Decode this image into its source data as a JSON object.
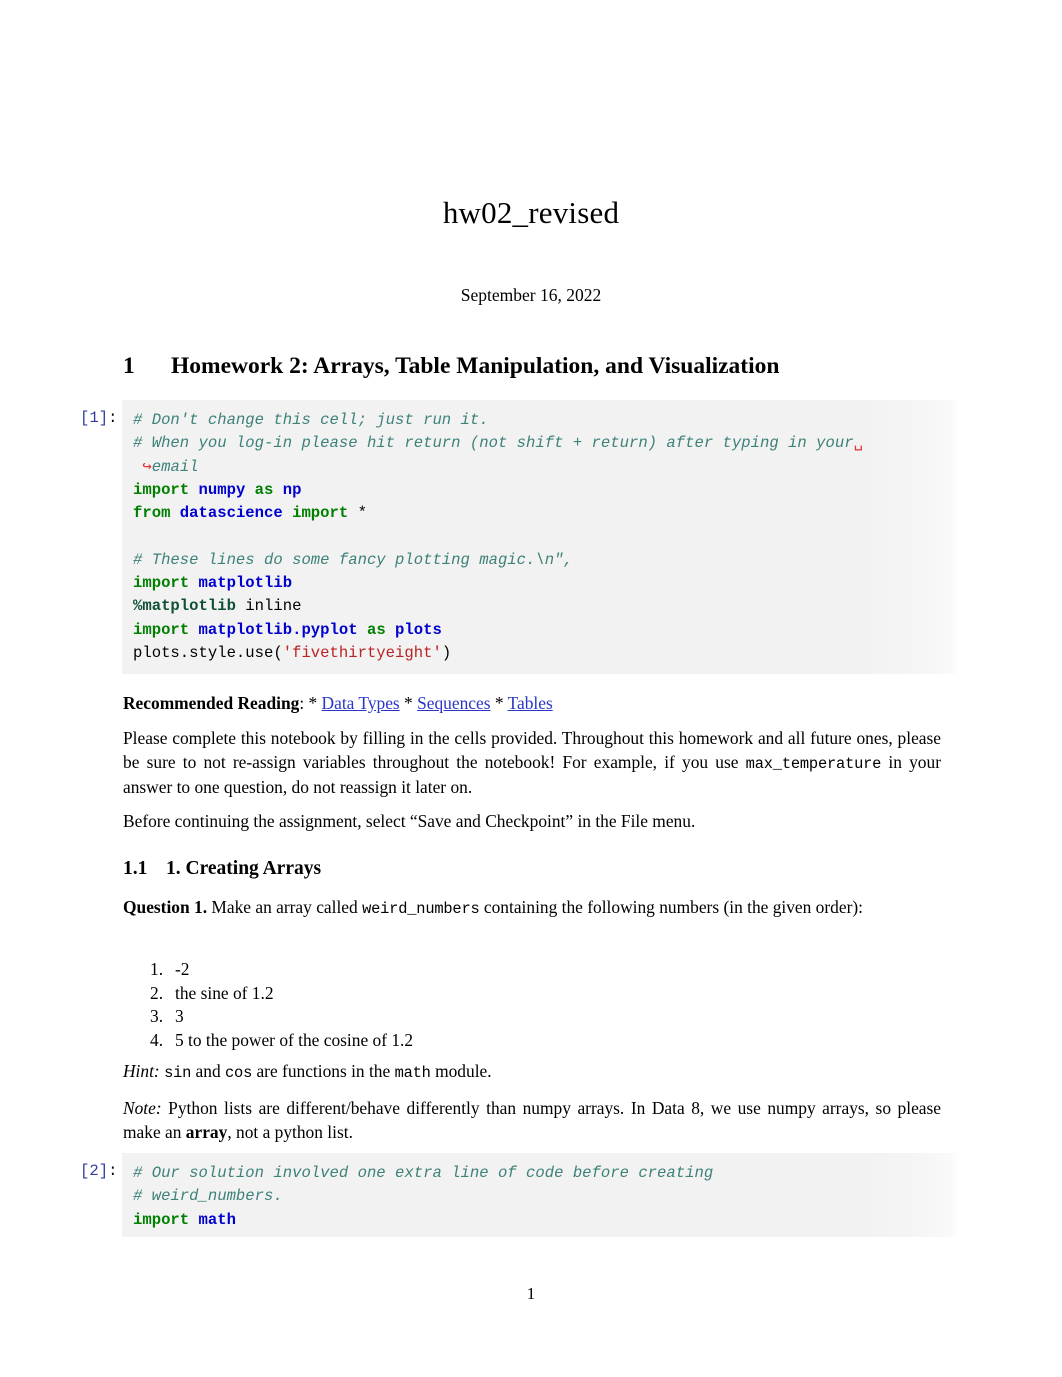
{
  "document": {
    "title": "hw02_revised",
    "date": "September 16, 2022",
    "page_number": "1"
  },
  "sections": {
    "h1": {
      "number": "1",
      "text": "Homework 2: Arrays, Table Manipulation, and Visualization"
    },
    "h2": {
      "number": "1.1",
      "text": "1. Creating Arrays"
    }
  },
  "cells": [
    {
      "label": "[1]",
      "lines": [
        "# Don't change this cell; just run it.",
        "# When you log-in please hit return (not shift + return) after typing in your",
        "email",
        "import numpy as np",
        "from datascience import *",
        "",
        "# These lines do some fancy plotting magic.\\n\",",
        "import matplotlib",
        "%matplotlib inline",
        "import matplotlib.pyplot as plots",
        "plots.style.use('fivethirtyeight')"
      ],
      "tokens": {
        "comment1": "# Don't change this cell; just run it.",
        "comment2": "# When you log-in please hit return (not shift + return) after typing in your",
        "wrap_space": "␣",
        "wrap_arrow": "↪",
        "comment2_cont": "email",
        "kw_import": "import",
        "mod_numpy": "numpy",
        "kw_as": "as",
        "mod_np": "np",
        "kw_from": "from",
        "mod_datascience": "datascience",
        "star": "*",
        "comment3": "# These lines do some fancy plotting magic.\\n\",",
        "mod_matplotlib": "matplotlib",
        "magic": "%matplotlib",
        "magic_arg": "inline",
        "mod_pyplot": "matplotlib.pyplot",
        "mod_plots": "plots",
        "plain_style": "plots.style.use(",
        "str_style": "'fivethirtyeight'",
        "plain_close": ")"
      }
    },
    {
      "label": "[2]",
      "tokens": {
        "comment1": "# Our solution involved one extra line of code before creating",
        "comment2": "# weird_numbers.",
        "kw_import": "import",
        "mod_math": "math"
      }
    }
  ],
  "reading": {
    "label": "Recommended Reading",
    "colon": ": ",
    "sep": " * ",
    "star": "* ",
    "links": [
      "Data Types",
      "Sequences",
      "Tables"
    ]
  },
  "paragraphs": {
    "instructions_a": "Please complete this notebook by filling in the cells provided. Throughout this homework and all future ones, please be sure to not re-assign variables throughout the notebook! For example, if you use ",
    "instructions_code": "max_temperature",
    "instructions_b": " in your answer to one question, do not reassign it later on.",
    "checkpoint": "Before continuing the assignment, select “Save and Checkpoint” in the File menu.",
    "question_label": "Question 1.",
    "question_a": " Make an array called ",
    "question_code": "weird_numbers",
    "question_b": " containing the following numbers (in the given order):",
    "hint_label": "Hint:",
    "hint_a": " ",
    "hint_code1": "sin",
    "hint_b": " and ",
    "hint_code2": "cos",
    "hint_c": " are functions in the ",
    "hint_code3": "math",
    "hint_d": " module.",
    "note_label": "Note:",
    "note_a": " Python lists are different/behave differently than numpy arrays. In Data 8, we use numpy arrays, so please make an ",
    "note_bold": "array",
    "note_b": ", not a python list."
  },
  "list_items": [
    {
      "marker": "1.",
      "text": "-2"
    },
    {
      "marker": "2.",
      "text": "the sine of 1.2"
    },
    {
      "marker": "3.",
      "text": "3"
    },
    {
      "marker": "4.",
      "text": "5 to the power of the cosine of 1.2"
    }
  ],
  "colors": {
    "link": "#2a36c8",
    "cell_label": "#303f9f",
    "code_background": "#f2f2f2",
    "comment": "#3d8179",
    "keyword": "#007f00",
    "module": "#0000cf",
    "string": "#bb2222",
    "wrap_marker": "#e03030"
  }
}
